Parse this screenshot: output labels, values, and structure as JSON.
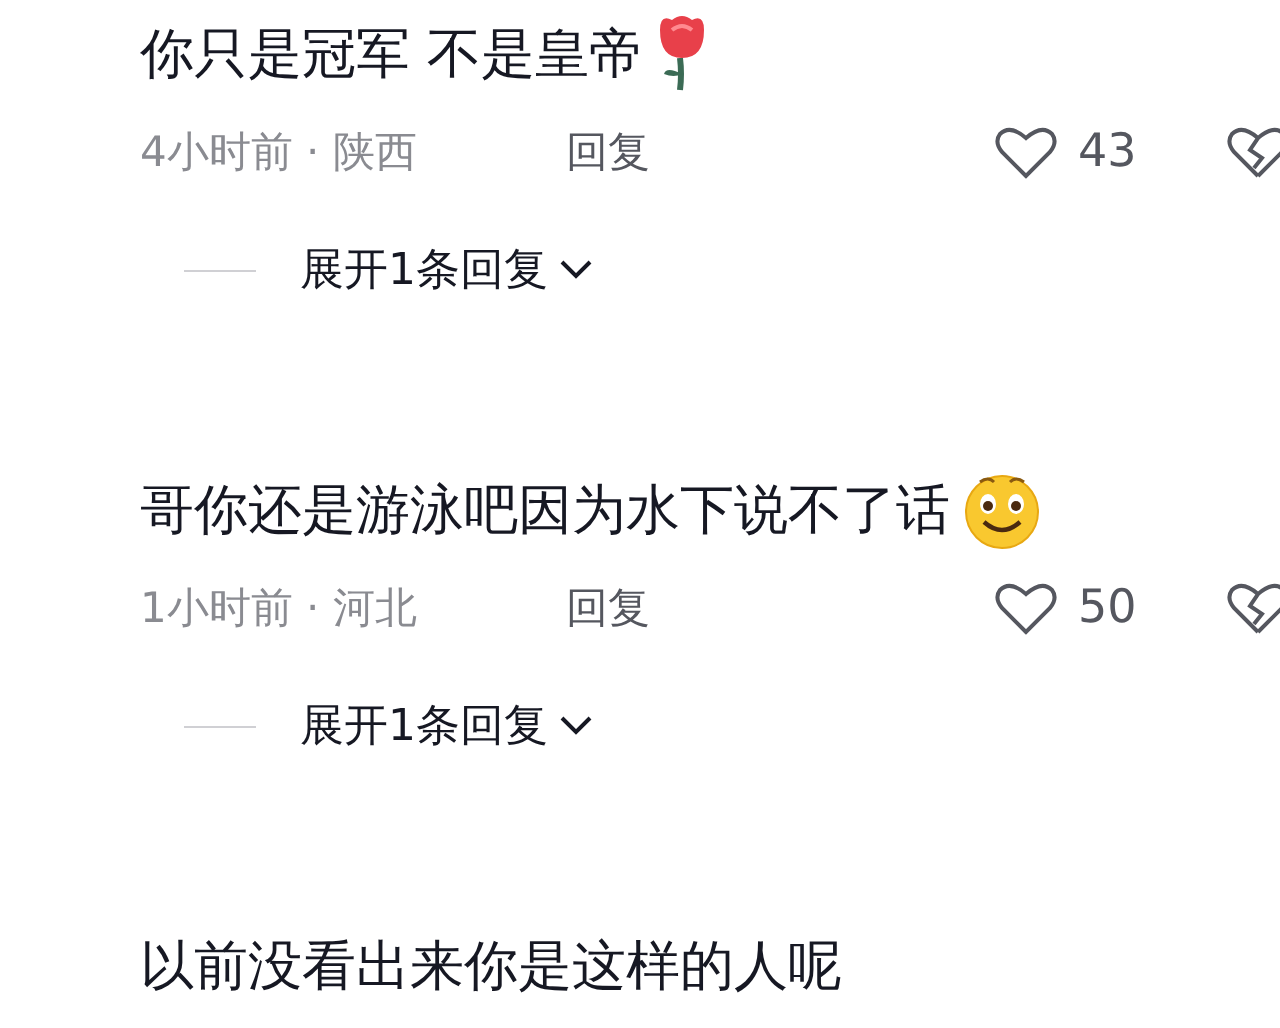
{
  "comments": [
    {
      "text": "你只是冠军 不是皇帝",
      "kind": "rose",
      "meta": "4小时前 · 陕西",
      "reply": "回复",
      "likes": "43",
      "expand": "展开1条回复"
    },
    {
      "text": "哥你还是游泳吧因为水下说不了话",
      "kind": "smile",
      "meta": "1小时前 · 河北",
      "reply": "回复",
      "likes": "50",
      "expand": "展开1条回复"
    },
    {
      "text": "以前没看出来你是这样的人呢"
    }
  ]
}
